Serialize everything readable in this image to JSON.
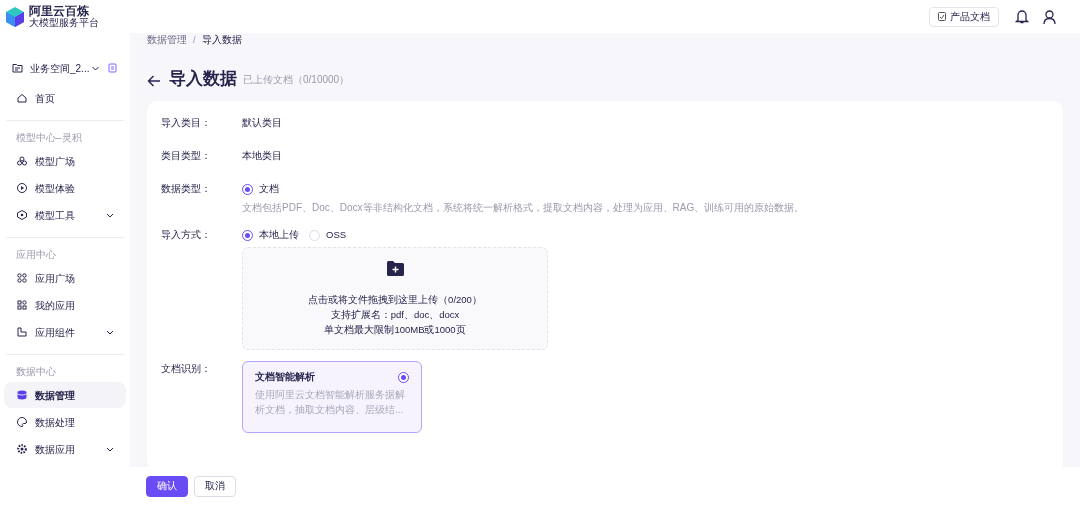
{
  "header": {
    "brand": "阿里云百炼",
    "tagline": "大模型服务平台",
    "docs_button": "产品文档"
  },
  "sidebar": {
    "workspace": "业务空间_2...",
    "top_items": [
      {
        "label": "首页",
        "selected": false
      }
    ],
    "sections": [
      {
        "title": "模型中心–灵积",
        "items": [
          {
            "label": "模型广场",
            "selected": false,
            "expandable": false
          },
          {
            "label": "模型体验",
            "selected": false,
            "expandable": false
          },
          {
            "label": "模型工具",
            "selected": false,
            "expandable": true
          }
        ]
      },
      {
        "title": "应用中心",
        "items": [
          {
            "label": "应用广场",
            "selected": false,
            "expandable": false
          },
          {
            "label": "我的应用",
            "selected": false,
            "expandable": false
          },
          {
            "label": "应用组件",
            "selected": false,
            "expandable": true
          }
        ]
      },
      {
        "title": "数据中心",
        "items": [
          {
            "label": "数据管理",
            "selected": true,
            "expandable": false
          },
          {
            "label": "数据处理",
            "selected": false,
            "expandable": false
          },
          {
            "label": "数据应用",
            "selected": false,
            "expandable": true
          }
        ]
      }
    ]
  },
  "breadcrumb": [
    "数据管理",
    "/",
    "导入数据"
  ],
  "title": "导入数据",
  "subtitle": "已上传文档（0/10000）",
  "form": [
    {
      "kind": "text",
      "label": "导入类目：",
      "value": "默认类目"
    },
    {
      "kind": "text",
      "label": "类目类型：",
      "value": "本地类目"
    },
    {
      "kind": "radio",
      "label": "数据类型：",
      "options": [
        {
          "label": "文档",
          "selected": true
        }
      ],
      "hint": "文档包括PDF、Doc、Docx等非结构化文档，系统将统一解析格式，提取文档内容，处理为应用、RAG、训练可用的原始数据。"
    },
    {
      "kind": "radio",
      "label": "导入方式：",
      "options": [
        {
          "label": "本地上传",
          "selected": true
        },
        {
          "label": "OSS",
          "selected": false
        }
      ]
    },
    {
      "kind": "upload",
      "lines": [
        "点击或将文件拖拽到这里上传（0/200）",
        "支持扩展名：pdf、doc、docx",
        "单文档最大限制100MB或1000页"
      ]
    },
    {
      "kind": "cards",
      "label": "文档识别：",
      "cards": [
        {
          "title": "文档智能解析",
          "description": "使用阿里云文档智能解析服务据解析文档，抽取文档内容、层级结...",
          "selected": true
        }
      ]
    }
  ],
  "buttons": [
    {
      "label": "确认",
      "primary": true
    },
    {
      "label": "取消",
      "primary": false
    }
  ]
}
